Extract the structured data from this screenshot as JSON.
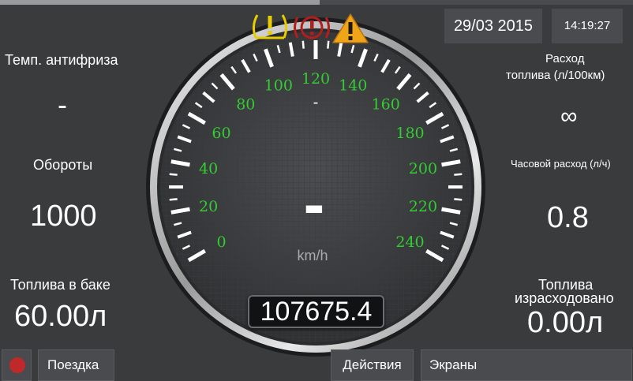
{
  "header": {
    "date": "29/03 2015",
    "time": "14:19:27"
  },
  "left_panel": {
    "coolant_label": "Темп. антифриза",
    "coolant_value": "-",
    "rpm_label": "Обороты",
    "rpm_value": "1000",
    "tank_label": "Топлива в баке",
    "tank_value": "60.00л"
  },
  "right_panel": {
    "consumption_label_line1": "Расход",
    "consumption_label_line2": "топлива (л/100км)",
    "consumption_value": "∞",
    "hourly_label": "Часовой расход (л/ч)",
    "hourly_value": "0.8",
    "used_label_line1": "Топлива",
    "used_label_line2": "израсходовано",
    "used_value": "0.00л"
  },
  "speedometer": {
    "unit": "km/h",
    "speed_value": "-",
    "secondary_value": "-",
    "min": 0,
    "max": 240,
    "tick_labels": [
      "0",
      "20",
      "40",
      "60",
      "80",
      "100",
      "120",
      "140",
      "160",
      "180",
      "200",
      "220",
      "240"
    ],
    "odometer": "107675.4",
    "label_color": "#33cc33"
  },
  "warning_icons": [
    {
      "name": "tire-pressure-warning-icon",
      "color": "#e6cc00"
    },
    {
      "name": "brake-warning-icon",
      "color": "#b01e1e"
    },
    {
      "name": "general-warning-icon",
      "color": "#f0a418"
    }
  ],
  "buttons": {
    "trip": "Поездка",
    "actions": "Действия",
    "screens": "Экраны"
  },
  "record_color": "#c0282a"
}
